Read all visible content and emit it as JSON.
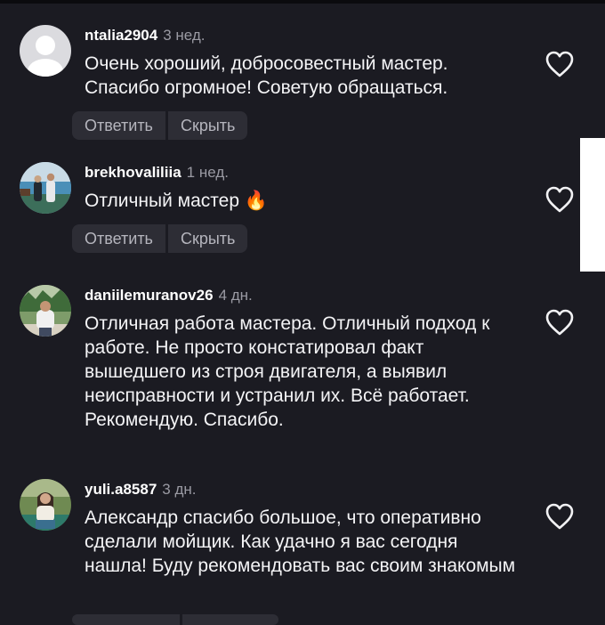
{
  "comments": [
    {
      "username": "ntalia2904",
      "time": "3 нед.",
      "text": "Очень хороший, добросовестный мастер. Спасибо огромное! Советую обращаться.",
      "actions": {
        "reply": "Ответить",
        "hide": "Скрыть"
      }
    },
    {
      "username": "brekhovaliliia",
      "time": "1 нед.",
      "text": "Отличный мастер",
      "emoji": "🔥",
      "actions": {
        "reply": "Ответить",
        "hide": "Скрыть"
      }
    },
    {
      "username": "daniilemuranov26",
      "time": "4 дн.",
      "text": "Отличная работа мастера. Отличный подход к работе. Не просто констатировал факт вышедшего из строя двигателя, а выявил неисправности и устранил их. Всё работает. Рекомендую. Спасибо."
    },
    {
      "username": "yuli.a8587",
      "time": "3 дн.",
      "text": "Александр спасибо большое, что оперативно сделали мойщик. Как удачно я вас сегодня нашла! Буду рекомендовать вас своим знакомым"
    }
  ],
  "icons": {
    "heart": "heart-outline-icon",
    "default_avatar": "default-avatar-icon",
    "fire": "fire-emoji"
  },
  "colors": {
    "background": "#1b1b22",
    "username": "#ffffff",
    "timestamp": "#9a9aa3",
    "action_pill": "#2d2d35",
    "action_text": "#b5b5bd"
  }
}
